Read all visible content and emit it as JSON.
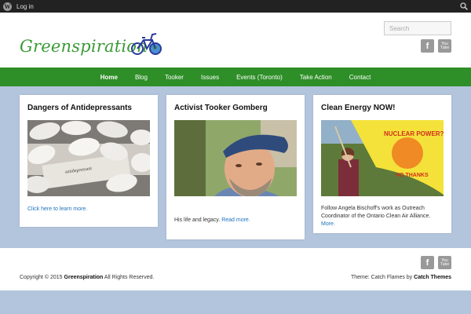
{
  "admin_bar": {
    "login": "Log in"
  },
  "header": {
    "site_title": "Greenspiration",
    "search_placeholder": "Search",
    "facebook": "f",
    "youtube_top": "You",
    "youtube_bottom": "Tube"
  },
  "nav": {
    "items": [
      "Home",
      "Blog",
      "Tooker",
      "Issues",
      "Events (Toronto)",
      "Take Action",
      "Contact"
    ]
  },
  "cards": [
    {
      "title": "Dangers of Antidepressants",
      "link": "Click here to learn more."
    },
    {
      "title": "Activist Tooker Gomberg",
      "text": "His life and legacy.",
      "link": "Read more."
    },
    {
      "title": "Clean Energy NOW!",
      "text": "Follow Angela Bischoff's work as Outreach Coordinator of the Ontario Clean Air Alliance.",
      "link": "More."
    }
  ],
  "footer": {
    "copyright_prefix": "Copyright © 2015",
    "copyright_site": "Greenspiration",
    "copyright_suffix": "All Rights Reserved.",
    "theme_prefix": "Theme: Catch Flames by",
    "theme_author": "Catch Themes"
  },
  "colors": {
    "admin_bar": "#222222",
    "brand_green": "#3a9a36",
    "nav_green": "#2e8e27",
    "background": "#b2c5dd",
    "link": "#1e73be"
  }
}
